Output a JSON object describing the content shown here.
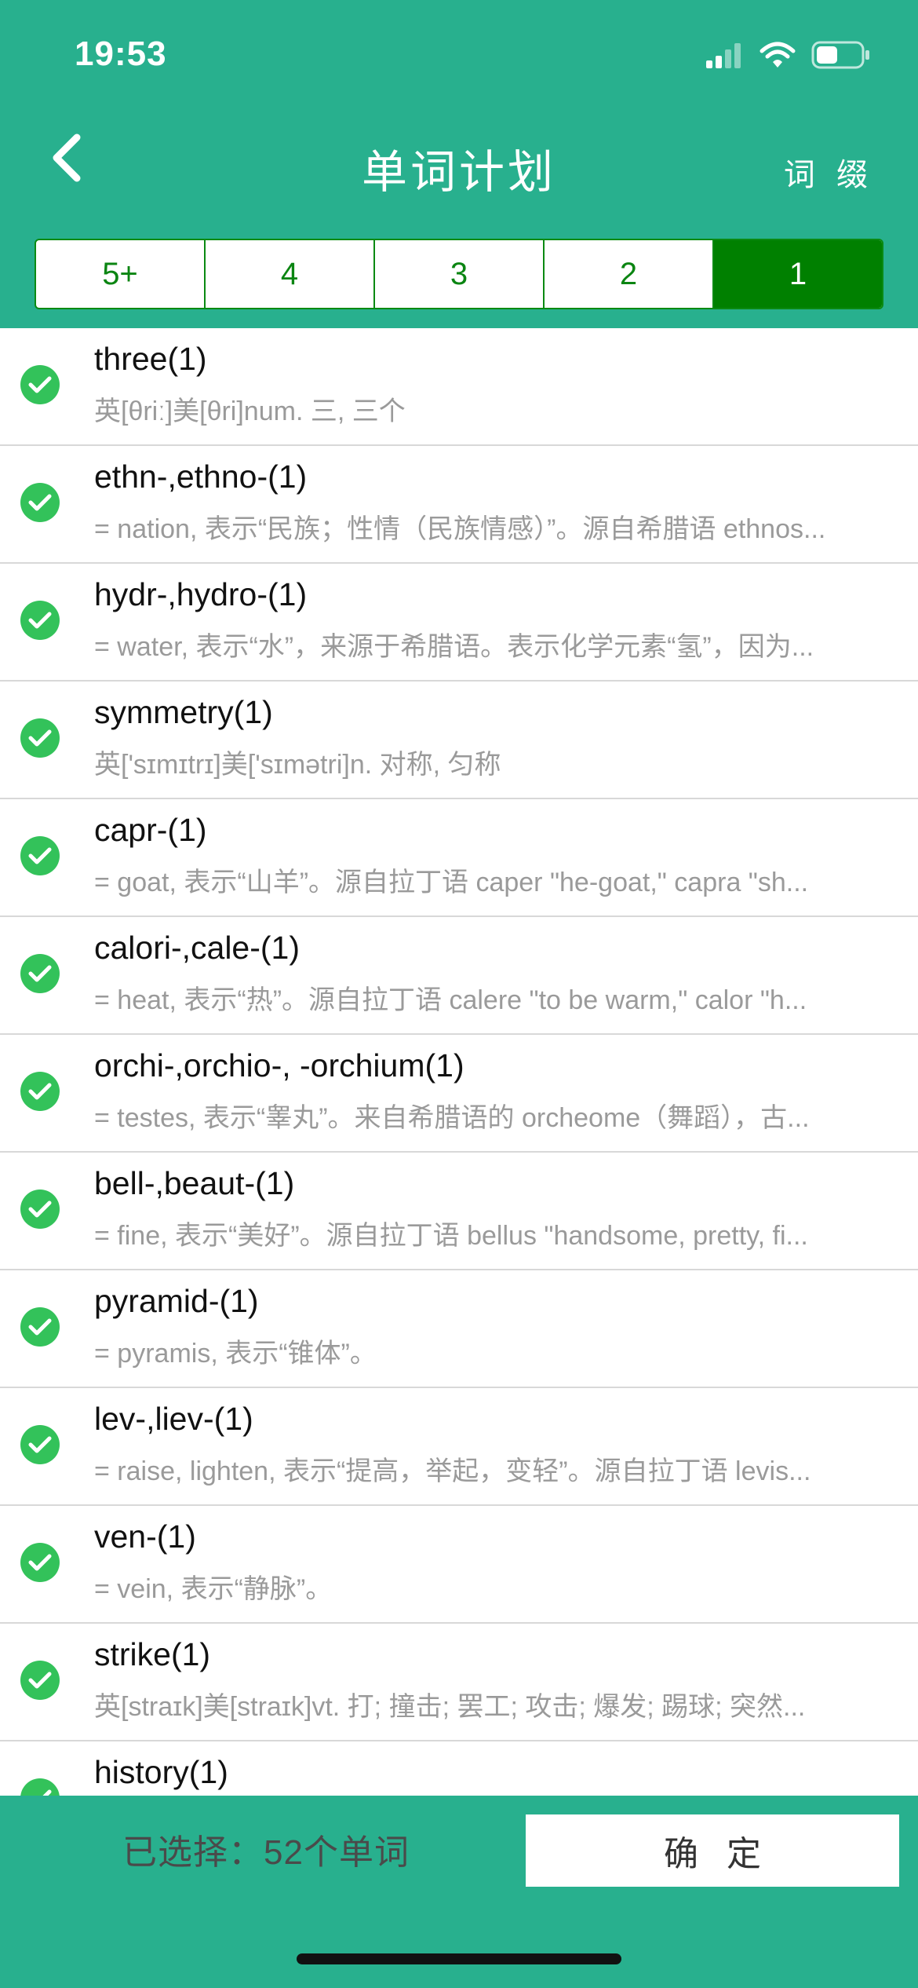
{
  "status_bar": {
    "time": "19:53",
    "icons": [
      "cellular-signal-icon",
      "wifi-icon",
      "battery-icon"
    ]
  },
  "nav": {
    "back_icon": "chevron-left-icon",
    "title": "单词计划",
    "right_button": "词 缀"
  },
  "segments": {
    "items": [
      "5+",
      "4",
      "3",
      "2",
      "1"
    ],
    "selected": "1"
  },
  "list": {
    "items": [
      {
        "word": "three(1)",
        "desc": "英[θriː]美[θri]num. 三, 三个"
      },
      {
        "word": "ethn-,ethno-(1)",
        "desc": "= nation, 表示“民族；性情（民族情感）”。源自希腊语 ethnos..."
      },
      {
        "word": "hydr-,hydro-(1)",
        "desc": "= water, 表示“水”，来源于希腊语。表示化学元素“氢”，因为..."
      },
      {
        "word": "symmetry(1)",
        "desc": "英['sɪmɪtrɪ]美['sɪmətri]n. 对称, 匀称"
      },
      {
        "word": "capr-(1)",
        "desc": "= goat, 表示“山羊”。源自拉丁语 caper \"he-goat,\" capra \"sh..."
      },
      {
        "word": "calori-,cale-(1)",
        "desc": "= heat, 表示“热”。源自拉丁语 calere \"to be warm,\" calor \"h..."
      },
      {
        "word": "orchi-,orchio-, -orchium(1)",
        "desc": "= testes, 表示“睾丸”。来自希腊语的 orcheome（舞蹈），古..."
      },
      {
        "word": "bell-,beaut-(1)",
        "desc": "= fine, 表示“美好”。源自拉丁语 bellus \"handsome, pretty, fi..."
      },
      {
        "word": "pyramid-(1)",
        "desc": "= pyramis, 表示“锥体”。"
      },
      {
        "word": "lev-,liev-(1)",
        "desc": "= raise, lighten, 表示“提高，举起，变轻”。源自拉丁语 levis..."
      },
      {
        "word": "ven-(1)",
        "desc": "= vein, 表示“静脉”。"
      },
      {
        "word": "strike(1)",
        "desc": "英[straɪk]美[straɪk]vt. 打; 撞击; 罢工; 攻击; 爆发; 踢球; 突然..."
      },
      {
        "word": "history(1)",
        "desc": ""
      }
    ],
    "check_icon": "checkmark-circle-icon",
    "check_color": "#33c25a"
  },
  "footer": {
    "selected_text": "已选择：52个单词",
    "confirm_label": "确定"
  },
  "colors": {
    "primary": "#28b08e",
    "segment_active": "#008000",
    "segment_text": "#0b8512"
  }
}
